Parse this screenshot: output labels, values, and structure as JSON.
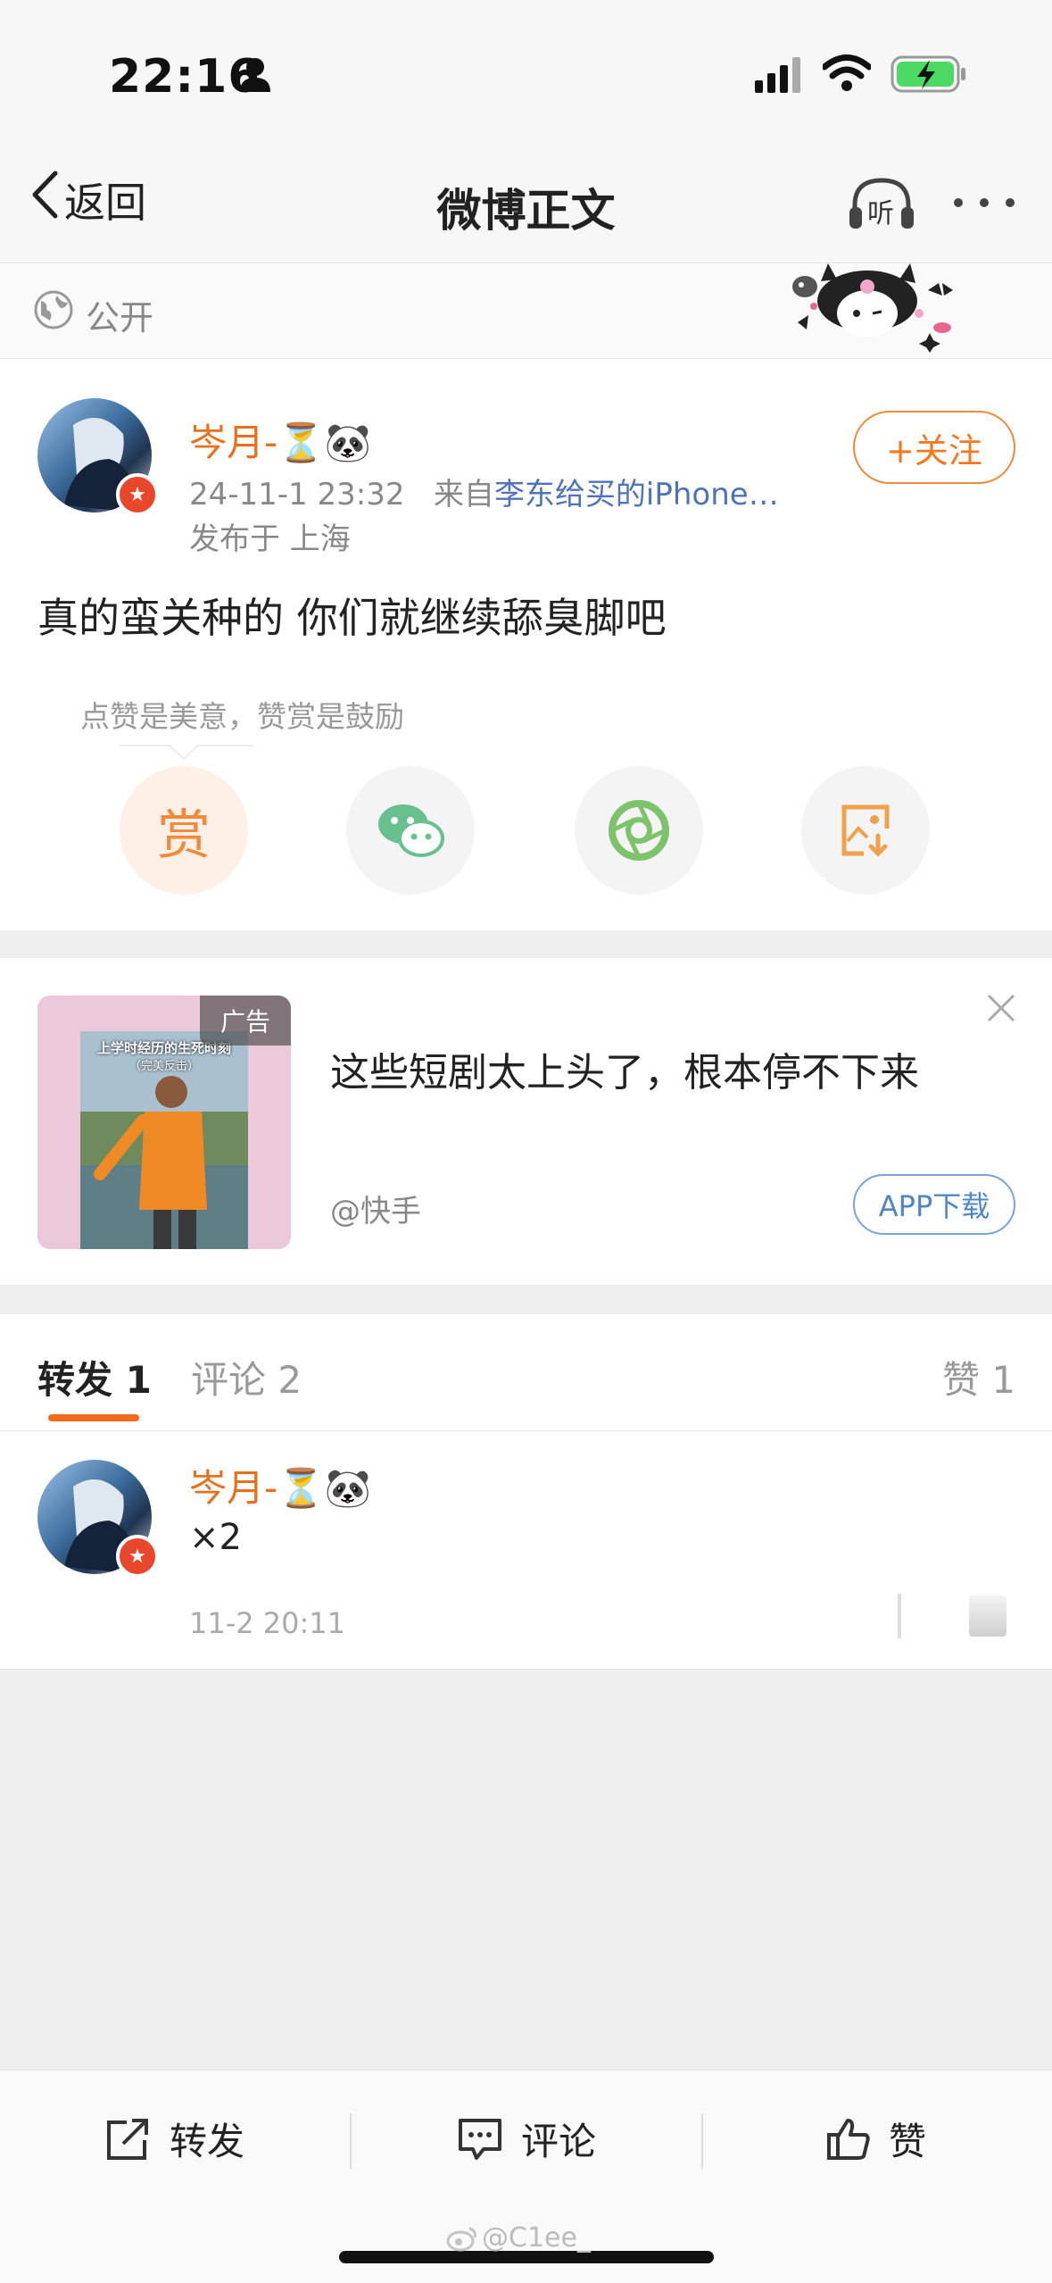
{
  "status_bar": {
    "time": "22:16"
  },
  "nav": {
    "back_label": "返回",
    "title": "微博正文",
    "listen_label": "听"
  },
  "visibility": {
    "label": "公开"
  },
  "post": {
    "author": "岑月-",
    "author_emoji": "⏳🐼",
    "time": "24-11-1 23:32",
    "source_prefix": "来自",
    "source": "李东给买的iPhone…",
    "location": "发布于 上海",
    "follow_label": "+关注",
    "text": "真的蛮关种的 你们就继续舔臭脚吧",
    "reward_hint": "点赞是美意，赞赏是鼓励",
    "reward_label": "赏"
  },
  "ad": {
    "badge": "广告",
    "image_caption": "上学时经历的生死时刻",
    "image_caption_sub": "（完美反击）",
    "title": "这些短剧太上头了，根本停不下来",
    "source": "@快手",
    "cta": "APP下载"
  },
  "tabs": [
    {
      "label": "转发",
      "count": "1"
    },
    {
      "label": "评论",
      "count": "2"
    },
    {
      "label": "赞",
      "count": "1"
    }
  ],
  "comment": {
    "author": "岑月-",
    "author_emoji": "⏳🐼",
    "text": "×2",
    "time": "11-2 20:11"
  },
  "bottom_bar": {
    "repost": "转发",
    "comment": "评论",
    "like": "赞"
  },
  "watermark": "@C1ee_",
  "colors": {
    "accent": "#e86f1e",
    "link": "#4f73b6",
    "background": "#efefef"
  }
}
